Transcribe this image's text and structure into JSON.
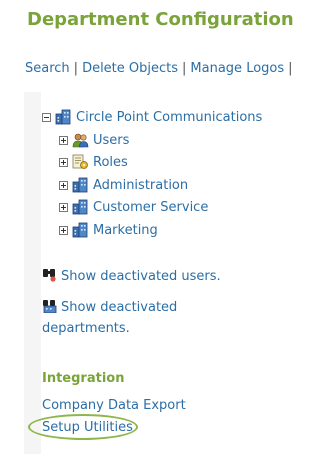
{
  "page": {
    "title": "Department Configuration"
  },
  "nav": {
    "links": [
      "Search",
      "Delete Objects",
      "Manage Logos"
    ],
    "separator": "|"
  },
  "tree": {
    "root": {
      "label": "Circle Point Communications",
      "icon": "building-icon",
      "expanded": true
    },
    "children": [
      {
        "label": "Users",
        "icon": "users-icon"
      },
      {
        "label": "Roles",
        "icon": "roles-icon"
      },
      {
        "label": "Administration",
        "icon": "building-icon"
      },
      {
        "label": "Customer Service",
        "icon": "building-icon"
      },
      {
        "label": "Marketing",
        "icon": "building-icon"
      }
    ]
  },
  "deactivated": {
    "users_label": "Show deactivated users.",
    "departments_label": "Show deactivated departments."
  },
  "integration": {
    "title": "Integration",
    "links": [
      "Company Data Export",
      "Setup Utilities"
    ]
  },
  "colors": {
    "link": "#2b6ea6",
    "accent_green": "#7aa33a",
    "highlight_ring": "#8db74a"
  }
}
